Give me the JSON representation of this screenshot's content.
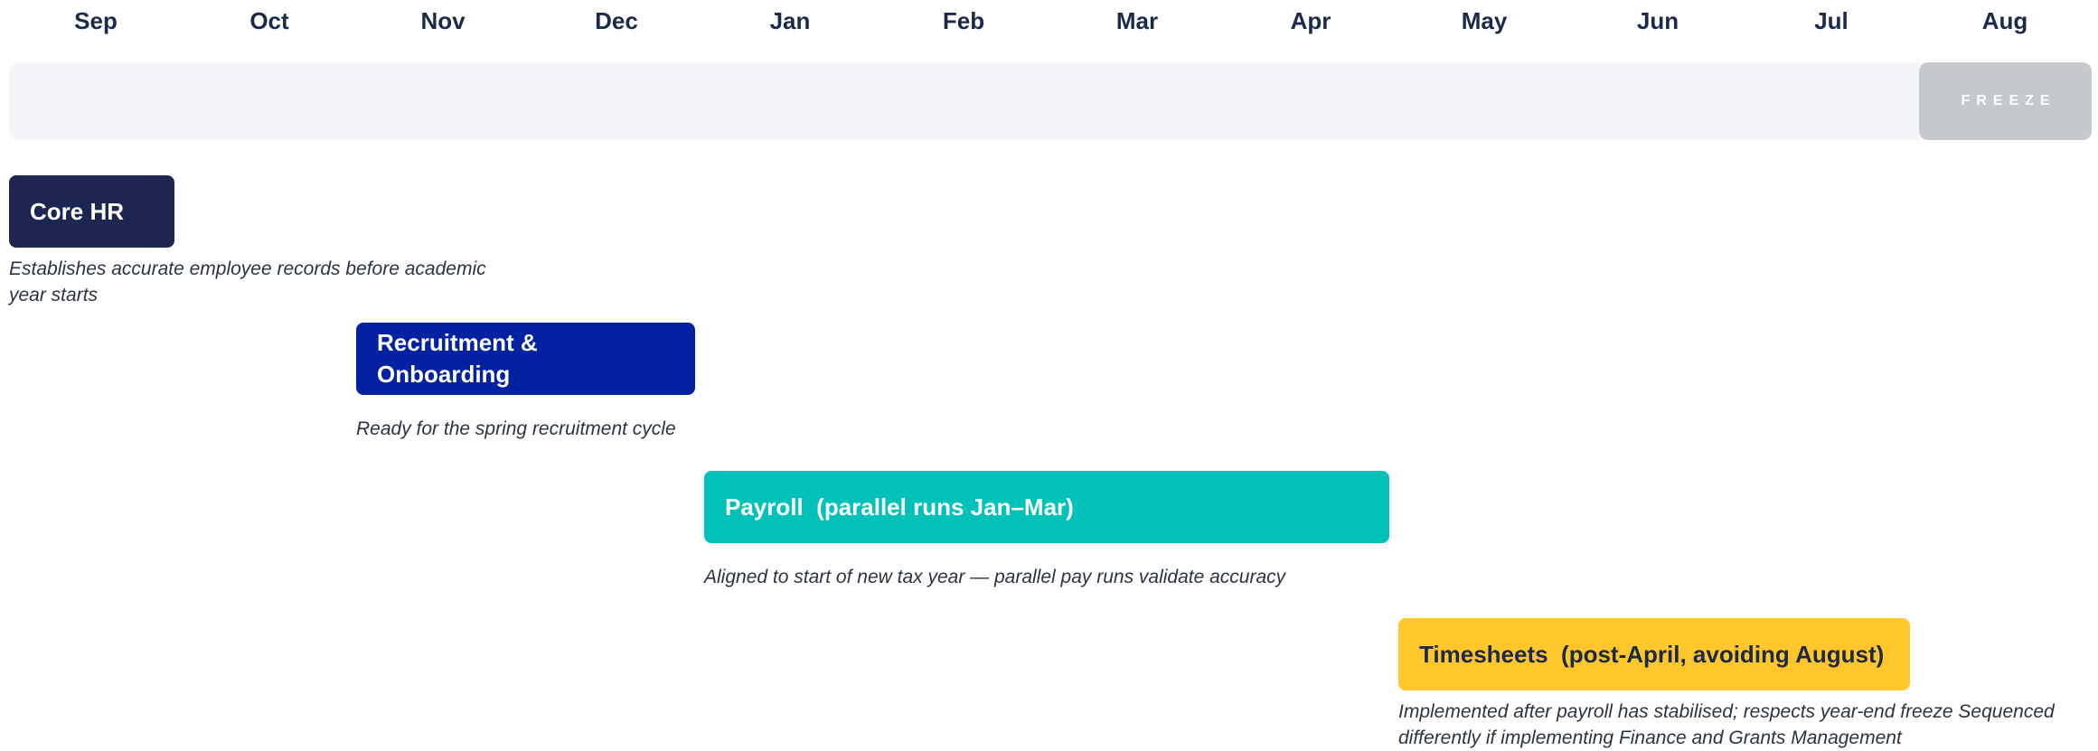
{
  "timeline": {
    "months": [
      "Sep",
      "Oct",
      "Nov",
      "Dec",
      "Jan",
      "Feb",
      "Mar",
      "Apr",
      "May",
      "Jun",
      "Jul",
      "Aug"
    ],
    "freeze_label": "FREEZE"
  },
  "phases": [
    {
      "name": "Core HR",
      "note": "Establishes accurate employee records before academic year starts",
      "color": "#1d2651",
      "start_month": "Sep"
    },
    {
      "name": "Recruitment & Onboarding",
      "note": "Ready for the spring recruitment cycle",
      "color": "#0322a2",
      "start_month": "Nov"
    },
    {
      "name": "Payroll  (parallel runs Jan–Mar)",
      "note": "Aligned to start of new tax year — parallel pay runs validate accuracy",
      "color": "#02c1b9",
      "start_month": "Jan"
    },
    {
      "name": "Timesheets  (post-April, avoiding August)",
      "note": "Implemented after payroll has stabilised; respects year-end freeze Sequenced differently if implementing Finance and Grants Management",
      "color": "#ffc72c",
      "start_month": "May"
    }
  ],
  "colors": {
    "band": "#f4f5f8",
    "freeze": "#c5c9cd",
    "month_text": "#1c2a4a"
  }
}
